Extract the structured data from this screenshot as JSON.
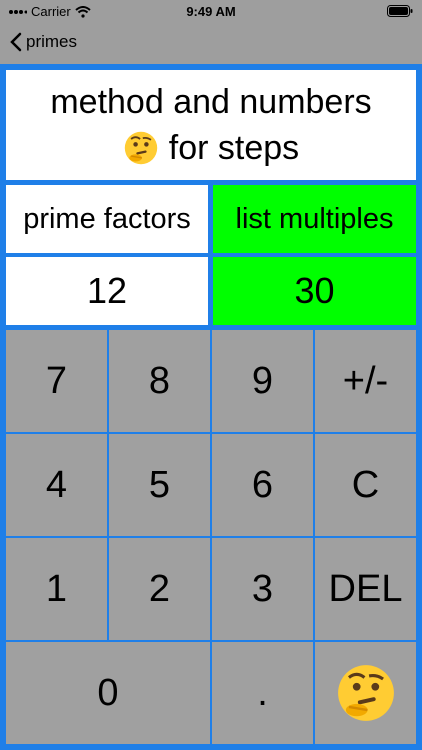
{
  "status_bar": {
    "carrier": "Carrier",
    "time": "9:49 AM"
  },
  "nav": {
    "back_label": "primes"
  },
  "header": {
    "line1": "method and numbers",
    "line2": "for steps"
  },
  "methods": {
    "left_label": "prime factors",
    "right_label": "list multiples",
    "selected": "list multiples"
  },
  "values": {
    "left": "12",
    "right": "30"
  },
  "keypad": {
    "k7": "7",
    "k8": "8",
    "k9": "9",
    "plusminus": "+/-",
    "k4": "4",
    "k5": "5",
    "k6": "6",
    "clear": "C",
    "k1": "1",
    "k2": "2",
    "k3": "3",
    "del": "DEL",
    "k0": "0",
    "dot": "."
  },
  "colors": {
    "frame": "#1f7fe8",
    "selected": "#00ff00",
    "key": "#a0a0a0",
    "background": "#9e9e9e"
  },
  "icons": {
    "thinking": "thinking-face-icon",
    "wifi": "wifi-icon",
    "battery": "battery-icon",
    "back": "chevron-left-icon"
  }
}
